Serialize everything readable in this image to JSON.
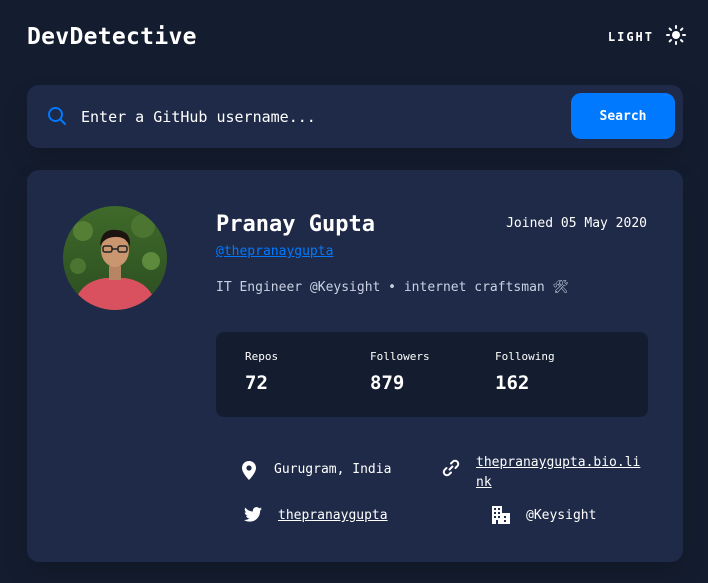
{
  "app": {
    "title": "DevDetective",
    "theme_label": "LIGHT",
    "theme_icon": "sun-icon"
  },
  "search": {
    "placeholder": "Enter a GitHub username...",
    "value": "",
    "button_label": "Search"
  },
  "profile": {
    "name": "Pranay Gupta",
    "login": "@thepranaygupta",
    "joined": "Joined 05 May 2020",
    "bio": "IT Engineer @Keysight • internet craftsman 🛠",
    "stats": [
      {
        "label": "Repos",
        "value": "72"
      },
      {
        "label": "Followers",
        "value": "879"
      },
      {
        "label": "Following",
        "value": "162"
      }
    ],
    "location": "Gurugram, India",
    "website_line1": "thepranaygupta.bio.li",
    "website_line2": "nk",
    "twitter": "thepranaygupta",
    "company": "@Keysight"
  },
  "colors": {
    "background": "#141d2f",
    "card": "#1e2a47",
    "accent": "#0079ff",
    "text": "#ffffff"
  }
}
